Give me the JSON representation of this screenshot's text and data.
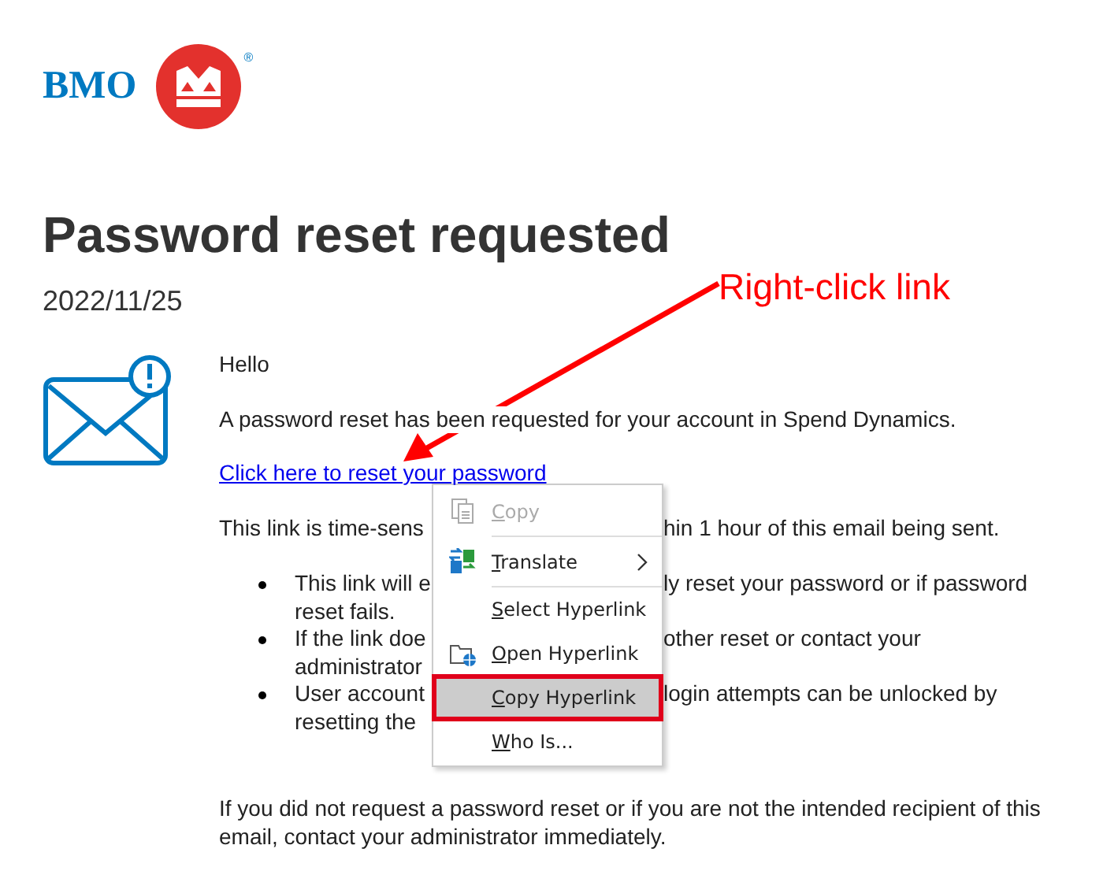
{
  "logo": {
    "wordmark": "BMO",
    "registered": "®"
  },
  "title": "Password reset requested",
  "date": "2022/11/25",
  "greeting": "Hello",
  "intro": "A password reset has been requested for your account in Spend Dynamics.",
  "link": "Click here to reset your password",
  "notice": {
    "left": "This link is time-sens",
    "right": "hin 1 hour of this email being sent."
  },
  "bullets": [
    {
      "lines": [
        {
          "left": "This link will e",
          "right": "ly reset your password or if password"
        },
        {
          "left": "reset fails."
        }
      ]
    },
    {
      "lines": [
        {
          "left": "If the link doe",
          "right": "other reset or contact your"
        },
        {
          "left": "administrator"
        }
      ]
    },
    {
      "lines": [
        {
          "left": "User account",
          "right": "login attempts can be unlocked by"
        },
        {
          "left": "resetting the"
        }
      ]
    }
  ],
  "closing": "If you did not request a password reset or if you are not the intended recipient of this email, contact your administrator immediately.",
  "context_menu": {
    "items": [
      {
        "label": "Copy",
        "disabled": true,
        "selected": false,
        "submenu": false,
        "separator_after": true,
        "annotated": false
      },
      {
        "label": "Translate",
        "disabled": false,
        "selected": false,
        "submenu": true,
        "separator_after": true,
        "annotated": false
      },
      {
        "label": "Select Hyperlink",
        "disabled": false,
        "selected": false,
        "submenu": false,
        "separator_after": false,
        "annotated": false
      },
      {
        "label": "Open Hyperlink",
        "disabled": false,
        "selected": false,
        "submenu": false,
        "separator_after": false,
        "annotated": false
      },
      {
        "label": "Copy Hyperlink",
        "disabled": false,
        "selected": true,
        "submenu": false,
        "separator_after": false,
        "annotated": true
      },
      {
        "label": "Who Is...",
        "disabled": false,
        "selected": false,
        "submenu": false,
        "separator_after": false,
        "annotated": false
      }
    ]
  },
  "annotation": {
    "text": "Right-click link"
  }
}
